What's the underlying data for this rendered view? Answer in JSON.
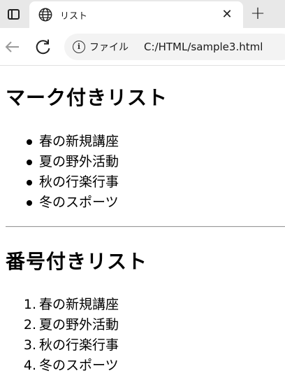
{
  "browser": {
    "tab_title": "リスト",
    "close_glyph": "✕",
    "new_tab_glyph": "+",
    "site_label": "ファイル",
    "url": "C:/HTML/sample3.html"
  },
  "page": {
    "heading_unordered": "マーク付きリスト",
    "unordered_items": [
      "春の新規講座",
      "夏の野外活動",
      "秋の行楽行事",
      "冬のスポーツ"
    ],
    "heading_ordered": "番号付きリスト",
    "ordered_items": [
      "春の新規講座",
      "夏の野外活動",
      "秋の行楽行事",
      "冬のスポーツ"
    ],
    "ordered_numbers": [
      "1.",
      "2.",
      "3.",
      "4."
    ]
  }
}
